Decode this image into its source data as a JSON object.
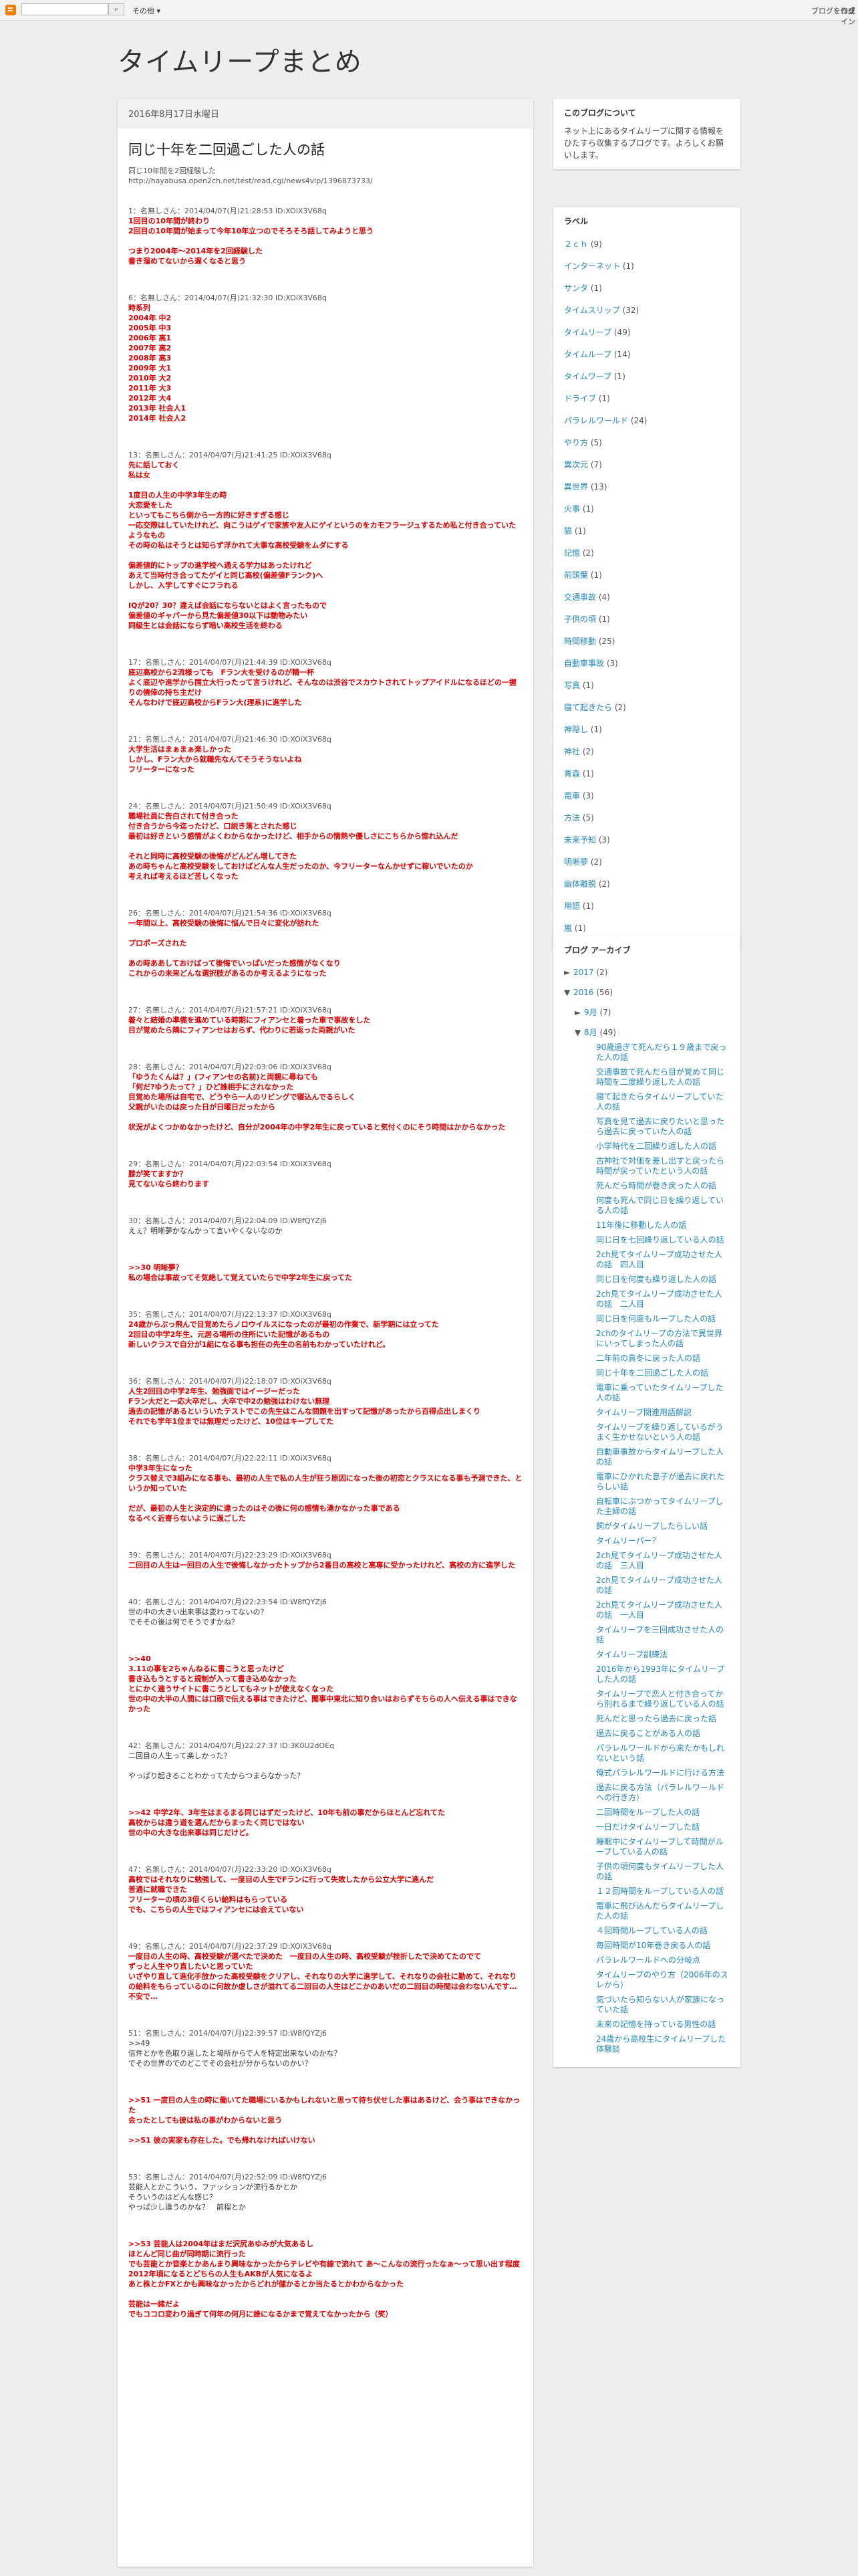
{
  "navbar": {
    "more_label": "その他 ▾",
    "create_blog": "ブログを作成",
    "login": "ログイン"
  },
  "blog": {
    "title": "タイムリープまとめ"
  },
  "post": {
    "date": "2016年8月17日水曜日",
    "title": "同じ十年を二回過ごした人の話",
    "intro": [
      "同じ10年間を2回経験した",
      "http://hayabusa.open2ch.net/test/read.cgi/news4vip/1396873733/"
    ],
    "responses": [
      {
        "header": "1：名無しさん：2014/04/07(月)21:28:53 ID:XOiX3V68q",
        "lines": [
          "1回目の10年間が終わり",
          "2回目の10年間が始まって今年10年立つのでそろそろ話してみようと思う",
          "",
          "つまり2004年〜2014年を2回経験した",
          "書き溜めてないから遅くなると思う"
        ]
      },
      {
        "header": "6：名無しさん：2014/04/07(月)21:32:30 ID:XOiX3V68q",
        "lines": [
          "時系列",
          "2004年 中2",
          "2005年 中3",
          "2006年 高1",
          "2007年 高2",
          "2008年 高3",
          "2009年 大1",
          "2010年 大2",
          "2011年 大3",
          "2012年 大4",
          "2013年 社会人1",
          "2014年 社会人2"
        ]
      },
      {
        "header": "13：名無しさん：2014/04/07(月)21:41:25 ID:XOiX3V68q",
        "lines": [
          "先に話しておく",
          "私は女",
          "",
          "1度目の人生の中学3年生の時",
          "大恋愛をした",
          "といってもこちら側から一方的に好きすぎる感じ",
          "一応交際はしていたけれど、向こうはゲイで家族や友人にゲイというのをカモフラージュするため私と付き合っていたようなもの",
          "その時の私はそうとは知らず浮かれて大事な高校受験をムダにする",
          "",
          "偏差値的にトップの進学校へ通える学力はあったけれど",
          "あえて当時付き合ってたゲイと同じ高校(偏差値Fランク)へ",
          "しかし、入学してすぐにフラれる",
          "",
          "IQが20？30？違えば会話にならないとはよく言ったもので",
          "偏差値のギャパーから見た偏差値30以下は動物みたい",
          "同級生とは会話にならず暗い高校生活を終わる"
        ]
      },
      {
        "header": "17：名無しさん：2014/04/07(月)21:44:39 ID:XOiX3V68q",
        "lines": [
          "底辺高校から2流様っても　Fラン大を受けるのが精一杯",
          "よく底辺や進学から国立大行ったって言うけれど、そんなのは渋谷でスカウトされてトップアイドルになるほどの一握りの僥倖の持ち主だけ",
          "そんなわけで底辺高校からFラン大(理系)に進学した"
        ]
      },
      {
        "header": "21：名無しさん：2014/04/07(月)21:46:30 ID:XOiX3V68q",
        "lines": [
          "大学生活はまぁまぁ楽しかった",
          "しかし、Fラン大から就職先なんてそうそうないよね",
          "フリーターになった"
        ]
      },
      {
        "header": "24：名無しさん：2014/04/07(月)21:50:49 ID:XOiX3V68q",
        "lines": [
          "職場社員に告白されて付き合った",
          "付き合うから今迄ったけど、口説き落とされた感じ",
          "最初は好きという感情がよくわからなかったけど、相手からの情熱や優しさにこちらから惚れ込んだ",
          "",
          "それと同時に高校受験の後悔がどんどん増してきた",
          "あの時ちゃんと高校受験をしておけばどんな人生だったのか、今フリーターなんかせずに稼いでいたのか",
          "考えれば考えるほど苦しくなった"
        ]
      },
      {
        "header": "26：名無しさん：2014/04/07(月)21:54:36 ID:XOiX3V68q",
        "lines": [
          "一年間以上、高校受験の後悔に悩んで日々に変化が訪れた",
          "",
          "プロポーズされた",
          "",
          "あの時ああしておけばって後悔でいっぱいだった感情がなくなり",
          "これからの未来どんな選択肢があるのか考えるようになった"
        ]
      },
      {
        "header": "27：名無しさん：2014/04/07(月)21:57:21 ID:XOiX3V68q",
        "lines": [
          "着々と結婚の準備を進めている時期にフィアンセと着った車で事故をした",
          "目が覚めたら隣にフィアンセはおらず、代わりに若返った両親がいた"
        ]
      },
      {
        "header": "28：名無しさん：2014/04/07(月)22:03:06 ID:XOiX3V68q",
        "lines": [
          "「ゆうたくんは？」(フィアンセの名前)と両親に尋ねても",
          "「何だ?ゆうたって？」ひど誰相手にされなかった",
          "目覚めた場所は自宅で、どうやら一人のリビングで寝込んでるらしく",
          "父親がいたのは戻った日が日曜日だったから",
          "",
          "状況がよくつかめなかったけど、自分が2004年の中学2年生に戻っていると気付くのにそう時間はかからなかった"
        ]
      },
      {
        "header": "29：名無しさん：2014/04/07(月)22:03:54 ID:XOiX3V68q",
        "lines": [
          "膝が笑てますか？",
          "見てないなら終わります"
        ]
      },
      {
        "header": "30：名無しさん：2014/04/07(月)22:04:09 ID:W8fQYZj6",
        "lines": [
          "えぇ？明晰夢かなんかって言いやくないなのか"
        ],
        "plain": true
      },
      {
        "header": "",
        "lines": [
          ">>30 明晰夢？",
          "私の場合は事故ってそ気絶して覚えていたらで中学2年生に戻ってた"
        ]
      },
      {
        "header": "35：名無しさん：2014/04/07(月)22:13:37 ID:XOiX3V68q",
        "lines": [
          "24歳からぶっ飛んで目覚めたらノロウイルスになったのが最初の作業で、新学期には立ってた",
          "2回目の中学2年生、元居る場所の住所にいた記憶があるもの",
          "新しいクラスで自分が1組になる事も担任の先生の名前もわかっていたけれど。"
        ]
      },
      {
        "header": "36：名無しさん：2014/04/07(月)22:18:07 ID:XOiX3V68q",
        "lines": [
          "人生2回目の中学2年生、勉強面ではイージーだった",
          "Fラン大だと一応大卒だし、大卒で中2の勉強はわけない無理",
          "過去の記憶があるといういたテストでこの先生はこんな問題を出すって記憶があったから百得点出しまくり",
          "それでも学年1位までは無理だったけど、10位はキープしてた"
        ]
      },
      {
        "header": "38：名無しさん：2014/04/07(月)22:22:11 ID:XOiX3V68q",
        "lines": [
          "中学3年生になった",
          "クラス替えで3組みになる事も、最初の人生で私の人生が狂う原因になった後の初恋とクラスになる事も予測できた、というか知っていた",
          "",
          "だが、最初の人生と決定的に違ったのはその後に何の感情も湧かなかった事である",
          "なるべく近寄らないように過ごした"
        ]
      },
      {
        "header": "39：名無しさん：2014/04/07(月)22:23:29 ID:XOiX3V68q",
        "lines": [
          "二回目の人生は一回目の人生で後悔しなかったトップから2番目の高校と高専に受かったけれど、高校の方に進学した"
        ]
      },
      {
        "header": "40：名無しさん：2014/04/07(月)22:23:54 ID:W8fQYZj6",
        "lines": [
          "世の中の大きい出来事は変わってないの？",
          "でそその後は何でそうですかね？"
        ],
        "plain": true
      },
      {
        "header": "",
        "lines": [
          ">>40",
          "3.11の事を2ちゃんねるに書こうと思ったけど",
          "書き込もうとすると規制が入って書き込めなかった",
          "とにかく連うサイトに書こうとしてもネットが使えなくなった",
          "世の中の大半の人間には口頭で伝える事はできたけど、聞事中東北に知り合いはおらずそちらの人へ伝える事はできなかった"
        ]
      },
      {
        "header": "42：名無しさん：2014/04/07(月)22:27:37 ID:3K0U2dOEq",
        "lines": [
          "二回目の人生って楽しかった？",
          "",
          "やっぱり起きることわかってたからつまらなかった？"
        ],
        "plain": true
      },
      {
        "header": "",
        "lines": [
          ">>42 中学2年、3年生はまるまる同じはずだったけど、10年も前の事だからほとんど忘れてた",
          "高校からは違う道を選んだからまったく同じではない",
          "世の中の大きな出来事は同じだけど。"
        ]
      },
      {
        "header": "47：名無しさん：2014/04/07(月)22:33:20 ID:XOiX3V68q",
        "lines": [
          "高校ではそれなりに勉強して、一度目の人生でFランに行って失敗したから公立大学に進んだ",
          "普通に就職できた",
          "フリーターの頃の3倍くらい給料はもらっている",
          "でも、こちらの人生ではフィアンセには会えていない"
        ]
      },
      {
        "header": "49：名無しさん：2014/04/07(月)22:37:29 ID:XOiX3V68q",
        "lines": [
          "一度目の人生の時、高校受験が選べたで決めた　一度目の人生の時、高校受験が挫折したで決めてたのでて",
          "ずっと人生やり直したいと思っていた",
          "いざやり直して進化手放かった高校受験をクリアし、それなりの大学に進学して、それなりの会社に勤めて、それなりの給料をもらっているのに何故か虚しさが溢れてる二回目の人生はどこかのあいだの二回目の時間は会わないんです…不安で…"
        ]
      },
      {
        "header": "51：名無しさん：2014/04/07(月)22:39:57 ID:W8fQYZj6",
        "lines": [
          ">>49",
          "信件とかを色取り返したと場所からで人を特定出来ないのかな？",
          "でその世界のでのどこでその会社が分からないのかい？"
        ],
        "plain": true
      },
      {
        "header": "",
        "lines": [
          ">>51 一度目の人生の時に働いてた職場にいるかもしれないと思って待ち伏せした事はあるけど、会う事はできなかった",
          "会ったとしても彼は私の事がわからないと思う",
          "",
          ">>51 彼の実家も存在した。でも帰れなければいけない"
        ]
      },
      {
        "header": "53：名無しさん：2014/04/07(月)22:52:09 ID:W8fQYZj6",
        "lines": [
          "芸能人とかこういう、ファッションが流行るかとか",
          "そういうのはどんな感じ？",
          "やっぱ少し違うのかな？　前程とか"
        ],
        "plain": true
      },
      {
        "header": "",
        "lines": [
          ">>53 芸能人は2004年はまだ沢尻あゆみが大気あるし",
          "ほとんど同じ曲が同時期に流行った",
          "でも芸能とか音楽とかあんまり興味なかったからテレビや有線で流れて あ〜こんなの流行ったなぁ〜って思い出す程度",
          "2012年頃になるとどちらの人生もAKBが人気になるよ",
          "あと株とかFXとかも興味なかったからどれが儲かるとか当たるとかわからなかった",
          "",
          "芸能は一緒だよ",
          "でもココロ変わり過ぎて何年の何月に誰になるかまで覚えてなかったから（笑）"
        ]
      }
    ]
  },
  "sidebar": {
    "about": {
      "title": "このブログについて",
      "text": "ネット上にあるタイムリープに関する情報をひたすら収集するブログです。よろしくお願いします。"
    },
    "labels": {
      "title": "ラベル",
      "items": [
        {
          "name": "２ｃｈ",
          "count": "(9)"
        },
        {
          "name": "インターネット",
          "count": "(1)"
        },
        {
          "name": "サンタ",
          "count": "(1)"
        },
        {
          "name": "タイムスリップ",
          "count": "(32)"
        },
        {
          "name": "タイムリープ",
          "count": "(49)"
        },
        {
          "name": "タイムループ",
          "count": "(14)"
        },
        {
          "name": "タイムワープ",
          "count": "(1)"
        },
        {
          "name": "ドライブ",
          "count": "(1)"
        },
        {
          "name": "パラレルワールド",
          "count": "(24)"
        },
        {
          "name": "やり方",
          "count": "(5)"
        },
        {
          "name": "異次元",
          "count": "(7)"
        },
        {
          "name": "異世界",
          "count": "(13)"
        },
        {
          "name": "火事",
          "count": "(1)"
        },
        {
          "name": "猫",
          "count": "(1)"
        },
        {
          "name": "記憶",
          "count": "(2)"
        },
        {
          "name": "前頭葉",
          "count": "(1)"
        },
        {
          "name": "交通事故",
          "count": "(4)"
        },
        {
          "name": "子供の頃",
          "count": "(1)"
        },
        {
          "name": "時間移動",
          "count": "(25)"
        },
        {
          "name": "自動車事故",
          "count": "(3)"
        },
        {
          "name": "写真",
          "count": "(1)"
        },
        {
          "name": "寝て起きたら",
          "count": "(2)"
        },
        {
          "name": "神隠し",
          "count": "(1)"
        },
        {
          "name": "神社",
          "count": "(2)"
        },
        {
          "name": "青森",
          "count": "(1)"
        },
        {
          "name": "電車",
          "count": "(3)"
        },
        {
          "name": "方法",
          "count": "(5)"
        },
        {
          "name": "未来予知",
          "count": "(3)"
        },
        {
          "name": "明晰夢",
          "count": "(2)"
        },
        {
          "name": "幽体離脱",
          "count": "(2)"
        },
        {
          "name": "用語",
          "count": "(1)"
        },
        {
          "name": "嵐",
          "count": "(1)"
        }
      ]
    },
    "archive": {
      "title": "ブログ アーカイブ",
      "years": [
        {
          "arrow": "►",
          "label": "2017",
          "count": "(2)"
        },
        {
          "arrow": "▼",
          "label": "2016",
          "count": "(56)"
        }
      ],
      "months": [
        {
          "arrow": "►",
          "label": "9月",
          "count": "(7)"
        },
        {
          "arrow": "▼",
          "label": "8月",
          "count": "(49)"
        }
      ],
      "posts": [
        "90歳過ぎて死んだら１９歳まで戻った人の話",
        "交通事故で死んだら目が覚めて同じ時間を二度繰り返した人の話",
        "寝て起きたらタイムリープしていた人の話",
        "写真を見て過去に戻りたいと思ったら過去に戻っていた人の話",
        "小学時代を二回繰り返した人の話",
        "古神社で対価を差し出すと戻ったら時間が戻っていたという人の話",
        "死んだら時間が巻き戻った人の話",
        "何度も死んで同じ日を繰り返している人の話",
        "11年後に移動した人の話",
        "同じ日を七回繰り返している人の話",
        "2ch見てタイムリープ成功させた人の話　四人目",
        "同じ日を何度も繰り返した人の話",
        "2ch見てタイムリープ成功させた人の話　二人目",
        "同じ日を何度もループした人の話",
        "2chのタイムリープの方法で異世界にいってしまった人の話",
        "二年前の真冬に戻った人の話",
        "同じ十年を二回過ごした人の話",
        "電車に乗っていたタイムリープした人の話",
        "タイムリープ関連用語解説",
        "タイムリープを繰り返しているがうまく生かせないという人の話",
        "自動車事故からタイムリープした人の話",
        "電車にひかれた息子が過去に戻れたらしい話",
        "自転車にぶつかってタイムリープした主婦の話",
        "飼がタイムリープしたらしい話",
        "タイムリーパー？",
        "2ch見てタイムリープ成功させた人の話　三人目",
        "2ch見てタイムリープ成功させた人の話",
        "2ch見てタイムリープ成功させた人の話　一人目",
        "タイムリープを三回成功させた人の話",
        "タイムリープ訓練法",
        "2016年から1993年にタイムリープした人の話",
        "タイムリープで恋人と付き合ってから別れるまで繰り返している人の話",
        "死んだと思ったら過去に戻った話",
        "過去に戻ることがある人の話",
        "パラレルワールドから来たかもしれないという話",
        "俺式パラレルワールドに行ける方法",
        "過去に戻る方法（パラレルワールドへの行き方）",
        "二回時間をループした人の話",
        "一日だけタイムリープした話",
        "睡眠中にタイムリープして時間がループしている人の話",
        "子供の頃何度もタイムリープした人の話",
        "１２回時間をループしている人の話",
        "電車に飛び込んだらタイムリープした人の話",
        "４回時間ループしている人の話",
        "毎回時間が10年巻き戻る人の話",
        "パラレルワールドへの分岐点",
        "タイムリープのやり方（2006年のスレから）",
        "気づいたら知らない人が家族になっていた話",
        "未来の記憶を持っている男性の話",
        "24歳から高校生にタイムリープした体験談"
      ]
    }
  }
}
